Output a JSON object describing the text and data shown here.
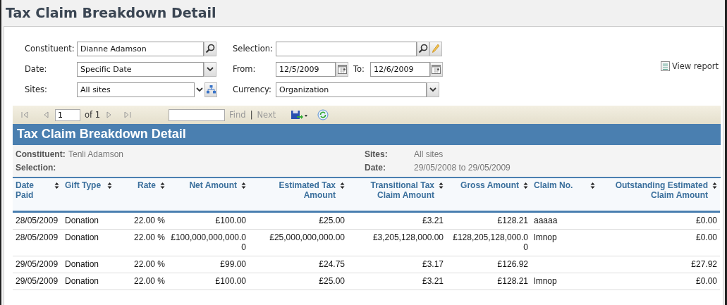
{
  "page_title": "Tax Claim Breakdown Detail",
  "form": {
    "left": [
      {
        "label": "Constituent:",
        "kind": "lookup",
        "value": "Dianne Adamson"
      },
      {
        "label": "Date:",
        "kind": "dropdown",
        "value": "Specific Date"
      },
      {
        "label": "Sites:",
        "kind": "sites",
        "value": "All sites"
      }
    ],
    "selection": {
      "label": "Selection:"
    },
    "from": {
      "label": "From:",
      "value": "12/5/2009"
    },
    "to": {
      "label": "To:",
      "value": "12/6/2009"
    },
    "currency": {
      "label": "Currency:",
      "value": "Organization"
    },
    "view_report": "View report"
  },
  "toolbar": {
    "page": "1",
    "of": "of 1",
    "find": "Find",
    "separator": "|",
    "next": "Next",
    "disabled": true
  },
  "report": {
    "title": "Tax Claim Breakdown Detail",
    "info": [
      {
        "label": "Constituent:",
        "value": "Tenli Adamson"
      },
      {
        "label": "Sites:",
        "value": "All sites"
      },
      {
        "label": "Selection:"
      },
      {
        "label": "Date:",
        "value": "29/05/2008 to 29/05/2009"
      }
    ],
    "columns": [
      {
        "label": "Date Paid"
      },
      {
        "label": "Gift Type"
      },
      {
        "label": "Rate"
      },
      {
        "label": "Net Amount"
      },
      {
        "label": "Estimated Tax Amount"
      },
      {
        "label": "Transitional Tax Claim Amount"
      },
      {
        "label": "Gross Amount"
      },
      {
        "label": "Claim No."
      },
      {
        "label": "Outstanding Estimated Claim Amount"
      }
    ],
    "rows": [
      [
        "28/05/2009",
        "Donation",
        "22.00 %",
        "£100.00",
        "£25.00",
        "£3.21",
        "£128.21",
        "aaaaa",
        "£0.00"
      ],
      [
        "28/05/2009",
        "Donation",
        "22.00 %",
        "£100,000,000,000.00",
        "£25,000,000,000.00",
        "£3,205,128,000.00",
        "£128,205,128,000.00",
        "lmnop",
        "£0.00"
      ],
      [
        "29/05/2009",
        "Donation",
        "22.00 %",
        "£99.00",
        "£24.75",
        "£3.17",
        "£126.92",
        "",
        "£27.92"
      ],
      [
        "29/05/2009",
        "Donation",
        "22.00 %",
        "£100.00",
        "£25.00",
        "£3.21",
        "£128.21",
        "lmnop",
        "£0.00"
      ]
    ]
  }
}
